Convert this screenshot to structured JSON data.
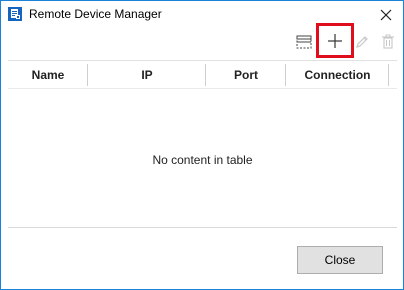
{
  "window": {
    "title": "Remote Device Manager",
    "icon": "device-manager-icon"
  },
  "titlebar": {
    "close_icon": "close-icon"
  },
  "toolbar": {
    "buttons": [
      {
        "name": "edit-columns",
        "icon": "columns-icon",
        "enabled": true
      },
      {
        "name": "add",
        "icon": "plus-icon",
        "enabled": true,
        "highlighted": true
      },
      {
        "name": "edit",
        "icon": "pencil-icon",
        "enabled": false
      },
      {
        "name": "delete",
        "icon": "trash-icon",
        "enabled": false
      }
    ]
  },
  "table": {
    "columns": [
      "Name",
      "IP",
      "Port",
      "Connection"
    ],
    "empty_message": "No content in table"
  },
  "footer": {
    "close_label": "Close"
  },
  "colors": {
    "window_border": "#1883d7",
    "highlight": "#e00d1d",
    "disabled_icon": "#c8c8c8",
    "button_face": "#e1e1e1"
  }
}
